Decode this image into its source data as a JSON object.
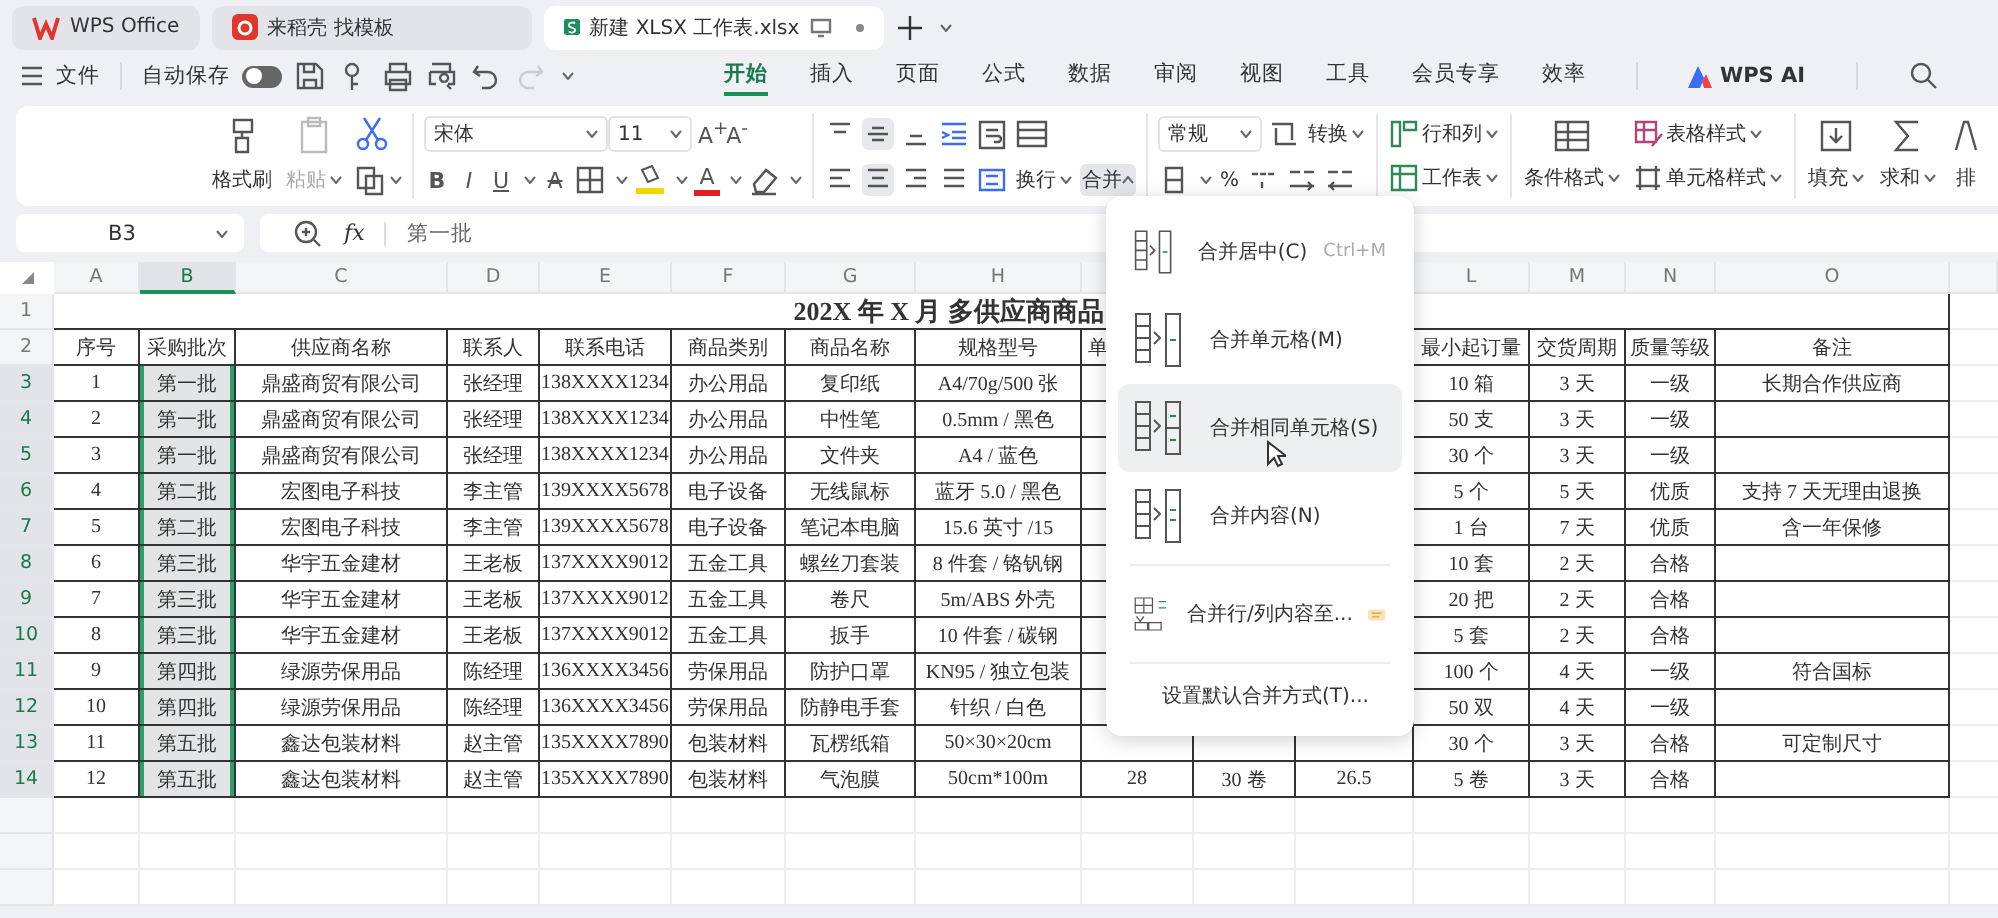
{
  "app_tabs": [
    {
      "label": "WPS Office",
      "kind": "home",
      "selected": false
    },
    {
      "label": "来稻壳 找模板",
      "kind": "template",
      "selected": false
    },
    {
      "label": "新建 XLSX 工作表.xlsx",
      "kind": "sheet",
      "selected": true
    }
  ],
  "menu_bar": {
    "file": "文件",
    "autosave": {
      "label": "自动保存",
      "on": false
    },
    "tabs": [
      {
        "label": "开始",
        "selected": true
      },
      {
        "label": "插入",
        "selected": false
      },
      {
        "label": "页面",
        "selected": false
      },
      {
        "label": "公式",
        "selected": false
      },
      {
        "label": "数据",
        "selected": false
      },
      {
        "label": "审阅",
        "selected": false
      },
      {
        "label": "视图",
        "selected": false
      },
      {
        "label": "工具",
        "selected": false
      },
      {
        "label": "会员专享",
        "selected": false
      },
      {
        "label": "效率",
        "selected": false
      }
    ],
    "ai": "WPS AI"
  },
  "ribbon": {
    "format_painter": "格式刷",
    "paste": "粘贴",
    "font": "宋体",
    "size": "11",
    "grow": "A$^{+}$",
    "shrink": "A$^{-}$",
    "styles": [
      {
        "label": "B",
        "kind": "bold"
      },
      {
        "label": "I",
        "kind": "italic"
      },
      {
        "label": "U",
        "kind": "underline"
      },
      {
        "label": "A",
        "kind": "strike"
      }
    ],
    "font_color": "A",
    "wrap": "换行",
    "merge": {
      "label": "合并",
      "open": true
    },
    "number_format": "常规",
    "convert": "转换",
    "percent": "%",
    "rows_cols": "行和列",
    "worksheet": "工作表",
    "cond_format": "条件格式",
    "table_style": "表格样式",
    "cell_style": "单元格样式",
    "fill": "填充",
    "sum": "求和",
    "sort": "排"
  },
  "formula_bar": {
    "cell": "B3",
    "fx": "fx",
    "value": "第一批"
  },
  "sheet": {
    "columns": [
      {
        "label": "A",
        "selected": false
      },
      {
        "label": "B",
        "selected": true
      },
      {
        "label": "C",
        "selected": false
      },
      {
        "label": "D",
        "selected": false
      },
      {
        "label": "E",
        "selected": false
      },
      {
        "label": "F",
        "selected": false
      },
      {
        "label": "G",
        "selected": false
      },
      {
        "label": "H",
        "selected": false
      },
      {},
      {},
      {},
      {
        "label": "L",
        "selected": false
      },
      {
        "label": "M",
        "selected": false
      },
      {
        "label": "N",
        "selected": false
      },
      {
        "label": "O",
        "selected": false
      }
    ],
    "title": "202X 年 X 月 多供应商商品",
    "rows": [
      {
        "number": "1",
        "selected": false,
        "kind": "title"
      },
      {
        "number": "2",
        "selected": false,
        "kind": "header",
        "cells": [
          "序号",
          "采购批次",
          "供应商名称",
          "联系人",
          "联系电话",
          "商品类别",
          "商品名称",
          "规格型号",
          "单",
          null,
          null,
          "最小起订量",
          "交货周期",
          "质量等级",
          "备注"
        ]
      },
      {
        "number": "3",
        "selected": true,
        "kind": "data",
        "cells": [
          "1",
          "第一批",
          "鼎盛商贸有限公司",
          "张经理",
          "138XXXX1234",
          "办公用品",
          "复印纸",
          "A4/70g/500 张",
          null,
          null,
          null,
          "10 箱",
          "3 天",
          "一级",
          "长期合作供应商"
        ]
      },
      {
        "number": "4",
        "selected": true,
        "kind": "data",
        "cells": [
          "2",
          "第一批",
          "鼎盛商贸有限公司",
          "张经理",
          "138XXXX1234",
          "办公用品",
          "中性笔",
          "0.5mm / 黑色",
          null,
          null,
          null,
          "50 支",
          "3 天",
          "一级",
          null
        ]
      },
      {
        "number": "5",
        "selected": true,
        "kind": "data",
        "cells": [
          "3",
          "第一批",
          "鼎盛商贸有限公司",
          "张经理",
          "138XXXX1234",
          "办公用品",
          "文件夹",
          "A4 / 蓝色",
          null,
          null,
          null,
          "30 个",
          "3 天",
          "一级",
          null
        ]
      },
      {
        "number": "6",
        "selected": true,
        "kind": "data",
        "cells": [
          "4",
          "第二批",
          "宏图电子科技",
          "李主管",
          "139XXXX5678",
          "电子设备",
          "无线鼠标",
          "蓝牙 5.0 / 黑色",
          null,
          null,
          null,
          "5 个",
          "5 天",
          "优质",
          "支持 7 天无理由退换"
        ]
      },
      {
        "number": "7",
        "selected": true,
        "kind": "data",
        "cells": [
          "5",
          "第二批",
          "宏图电子科技",
          "李主管",
          "139XXXX5678",
          "电子设备",
          "笔记本电脑",
          "15.6 英寸 /15",
          null,
          null,
          null,
          "1 台",
          "7 天",
          "优质",
          "含一年保修"
        ]
      },
      {
        "number": "8",
        "selected": true,
        "kind": "data",
        "cells": [
          "6",
          "第三批",
          "华宇五金建材",
          "王老板",
          "137XXXX9012",
          "五金工具",
          "螺丝刀套装",
          "8 件套 / 铬钒钢",
          null,
          null,
          null,
          "10 套",
          "2 天",
          "合格",
          null
        ]
      },
      {
        "number": "9",
        "selected": true,
        "kind": "data",
        "cells": [
          "7",
          "第三批",
          "华宇五金建材",
          "王老板",
          "137XXXX9012",
          "五金工具",
          "卷尺",
          "5m/ABS 外壳",
          null,
          null,
          null,
          "20 把",
          "2 天",
          "合格",
          null
        ]
      },
      {
        "number": "10",
        "selected": true,
        "kind": "data",
        "cells": [
          "8",
          "第三批",
          "华宇五金建材",
          "王老板",
          "137XXXX9012",
          "五金工具",
          "扳手",
          "10 件套 / 碳钢",
          null,
          null,
          null,
          "5 套",
          "2 天",
          "合格",
          null
        ]
      },
      {
        "number": "11",
        "selected": true,
        "kind": "data",
        "cells": [
          "9",
          "第四批",
          "绿源劳保用品",
          "陈经理",
          "136XXXX3456",
          "劳保用品",
          "防护口罩",
          "KN95 / 独立包装",
          null,
          null,
          null,
          "100 个",
          "4 天",
          "一级",
          "符合国标"
        ]
      },
      {
        "number": "12",
        "selected": true,
        "kind": "data",
        "cells": [
          "10",
          "第四批",
          "绿源劳保用品",
          "陈经理",
          "136XXXX3456",
          "劳保用品",
          "防静电手套",
          "针织 / 白色",
          null,
          null,
          null,
          "50 双",
          "4 天",
          "一级",
          null
        ]
      },
      {
        "number": "13",
        "selected": true,
        "kind": "data",
        "cells": [
          "11",
          "第五批",
          "鑫达包装材料",
          "赵主管",
          "135XXXX7890",
          "包装材料",
          "瓦楞纸箱",
          "50×30×20cm",
          null,
          null,
          null,
          "30 个",
          "3 天",
          "合格",
          "可定制尺寸"
        ]
      },
      {
        "number": "14",
        "selected": true,
        "kind": "data",
        "cells": [
          "12",
          "第五批",
          "鑫达包装材料",
          "赵主管",
          "135XXXX7890",
          "包装材料",
          "气泡膜",
          "50cm*100m",
          "28",
          "30 卷",
          "26.5",
          "5 卷",
          "3 天",
          "合格",
          null
        ]
      }
    ]
  },
  "merge_menu": {
    "items": [
      {
        "label": "合并居中(C)",
        "shortcut": "Ctrl+M",
        "kind": "center",
        "hovered": false
      },
      {
        "label": "合并单元格(M)",
        "kind": "merge",
        "hovered": false
      },
      {
        "label": "合并相同单元格(S)",
        "kind": "same",
        "hovered": true
      },
      {
        "label": "合并内容(N)",
        "kind": "content",
        "hovered": false
      },
      {
        "label": "合并行/列内容至...",
        "kind": "rowcol",
        "badge": true,
        "hovered": false
      }
    ],
    "footer": "设置默认合并方式(T)..."
  }
}
